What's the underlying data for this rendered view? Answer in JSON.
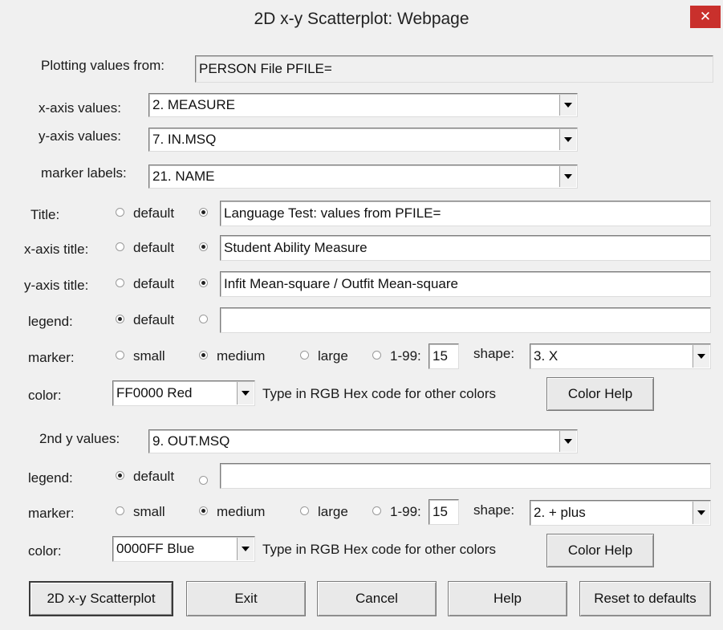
{
  "window": {
    "title": "2D x-y Scatterplot: Webpage",
    "close_glyph": "✕"
  },
  "plotting": {
    "label": "Plotting values from:",
    "value": "PERSON File PFILE="
  },
  "x_axis_values": {
    "label": "x-axis values:",
    "value": "2. MEASURE"
  },
  "y_axis_values": {
    "label": "y-axis values:",
    "value": "7. IN.MSQ"
  },
  "marker_labels": {
    "label": "marker labels:",
    "value": "21. NAME"
  },
  "title_row": {
    "label": "Title:",
    "default_label": "default",
    "value": "Language Test: values from PFILE=",
    "selected": "custom"
  },
  "x_axis_title": {
    "label": "x-axis title:",
    "default_label": "default",
    "value": "Student Ability Measure",
    "selected": "custom"
  },
  "y_axis_title": {
    "label": "y-axis title:",
    "default_label": "default",
    "value": "Infit Mean-square / Outfit Mean-square",
    "selected": "custom"
  },
  "legend1": {
    "label": "legend:",
    "default_label": "default",
    "value": "",
    "selected": "default"
  },
  "marker1": {
    "label": "marker:",
    "small": "small",
    "medium": "medium",
    "large": "large",
    "custom": "1-99:",
    "size_value": "15",
    "selected": "medium",
    "shape_label": "shape:",
    "shape_value": "3. X"
  },
  "color1": {
    "label": "color:",
    "value": "FF0000 Red",
    "hint": "Type in RGB Hex code for other colors",
    "help_button": "Color Help"
  },
  "second_y": {
    "label": "2nd y values:",
    "value": "9. OUT.MSQ"
  },
  "legend2": {
    "label": "legend:",
    "default_label": "default",
    "value": "",
    "selected": "default"
  },
  "marker2": {
    "label": "marker:",
    "small": "small",
    "medium": "medium",
    "large": "large",
    "custom": "1-99:",
    "size_value": "15",
    "selected": "medium",
    "shape_label": "shape:",
    "shape_value": "2. + plus"
  },
  "color2": {
    "label": "color:",
    "value": "0000FF Blue",
    "hint": "Type in RGB Hex code for other colors",
    "help_button": "Color Help"
  },
  "buttons": {
    "scatterplot": "2D x-y Scatterplot",
    "exit": "Exit",
    "cancel": "Cancel",
    "help": "Help",
    "reset": "Reset to defaults"
  },
  "colors": {
    "close_button": "#c9302c",
    "dialog_bg": "#f0f0f0"
  },
  "icons": {
    "close": "close-icon",
    "dropdown": "chevron-down-icon"
  }
}
